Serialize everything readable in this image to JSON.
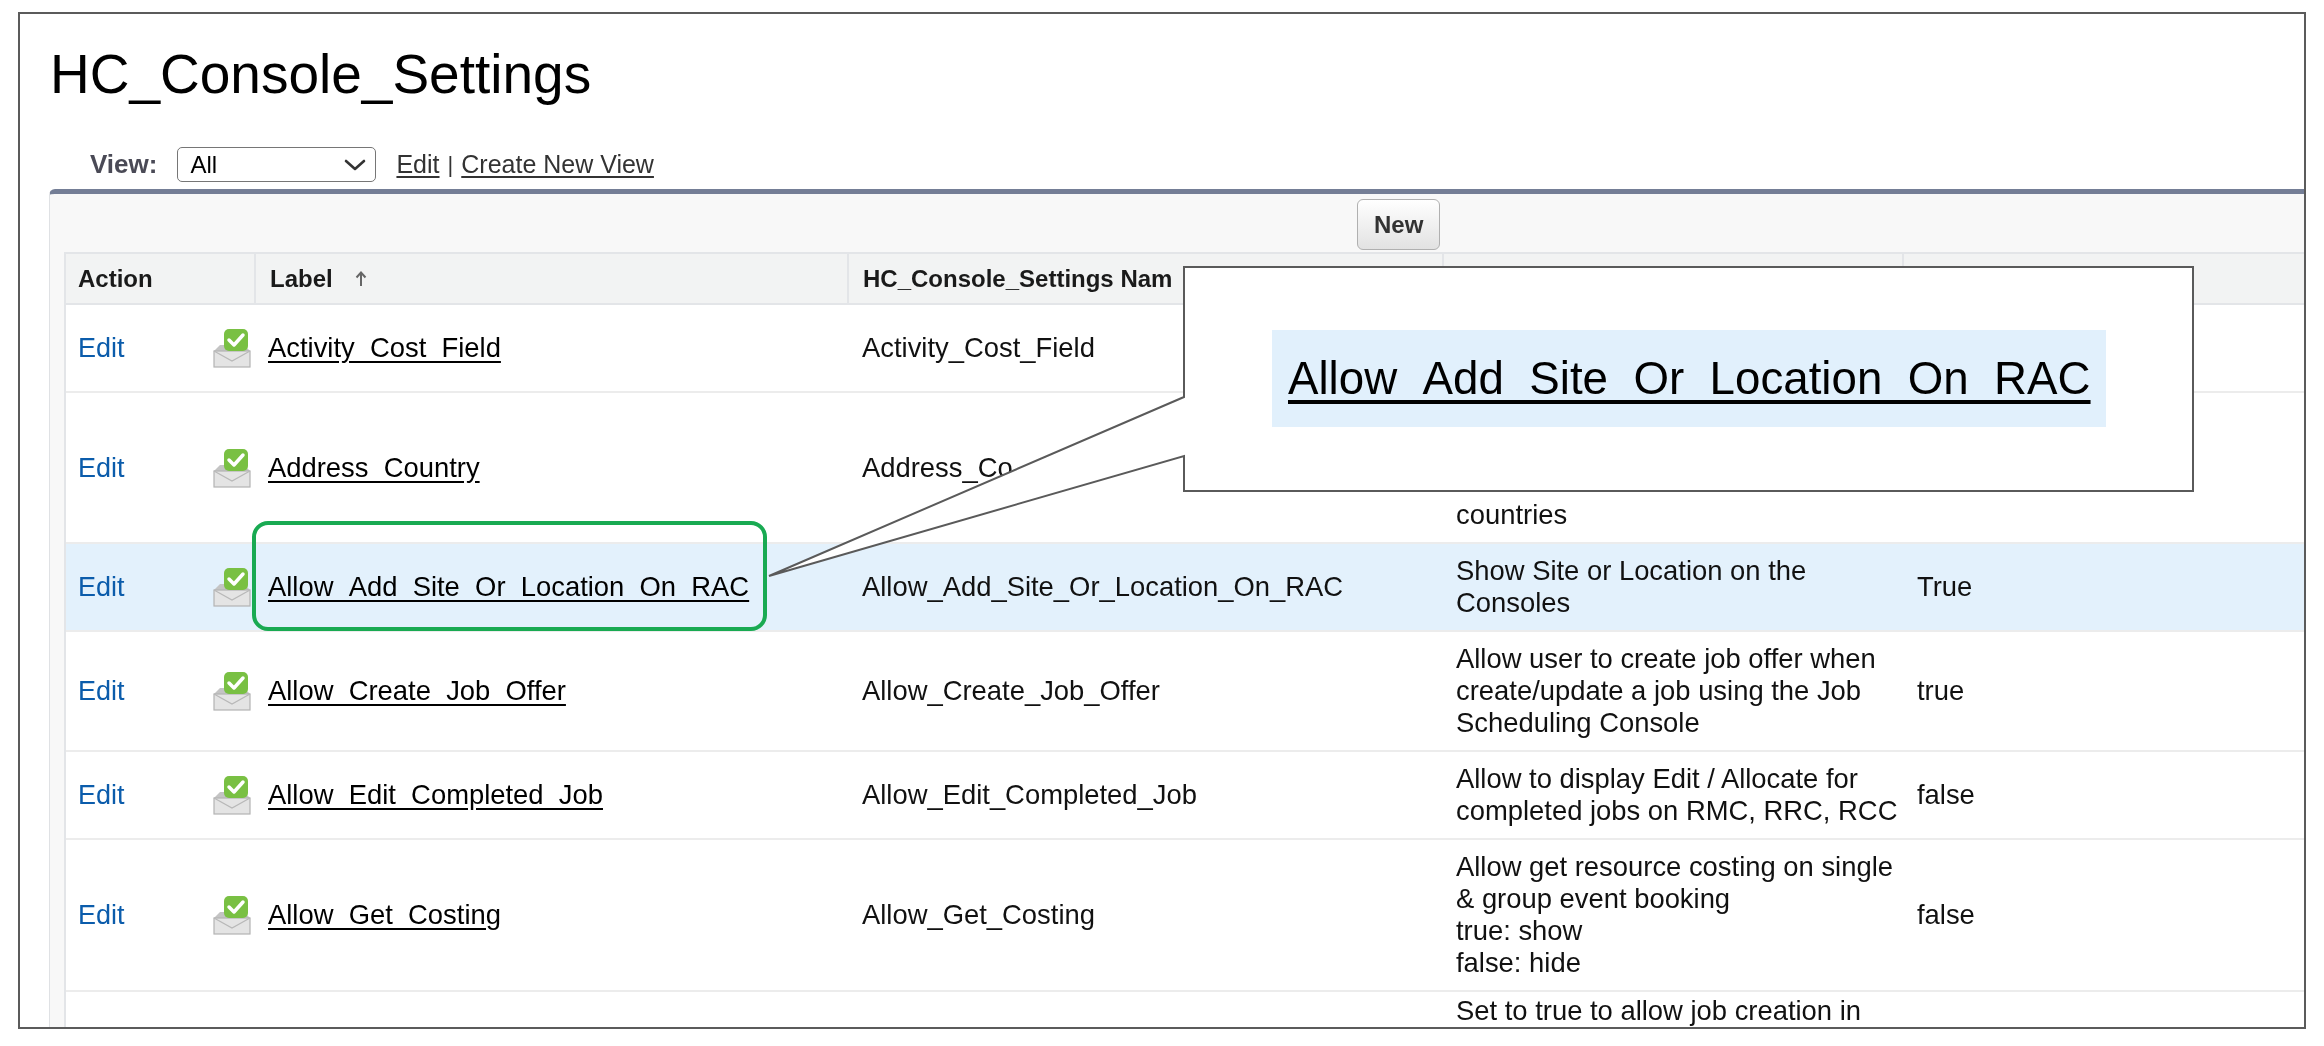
{
  "title": "HC_Console_Settings",
  "view_bar": {
    "label": "View:",
    "select": {
      "value": "All"
    },
    "links": [
      "Edit",
      "Create New View"
    ],
    "separator": "|"
  },
  "toolbar": {
    "buttons": [
      "New"
    ]
  },
  "table": {
    "columns": [
      {
        "label": "Action",
        "sorted": false
      },
      {
        "label": "Label",
        "sorted": true
      },
      {
        "label": "HC_Console_Settings Nam",
        "sorted": false
      }
    ],
    "rows": [
      {
        "action": "Edit",
        "label": "Activity_Cost_Field",
        "column_3": "Activity_Cost_Field",
        "highlighted": false,
        "framed": false
      },
      {
        "action": "Edit",
        "label": "Address_Country",
        "column_3": "Address_Co",
        "column_4": "countries",
        "highlighted": false,
        "framed": false
      },
      {
        "action": "Edit",
        "label": "Allow_Add_Site_Or_Location_On_RAC",
        "column_3": "Allow_Add_Site_Or_Location_On_RAC",
        "column_4": "Show Site or Location on the\nConsoles",
        "column_5": "True",
        "highlighted": true,
        "framed": true
      },
      {
        "action": "Edit",
        "label": "Allow_Create_Job_Offer",
        "column_3": "Allow_Create_Job_Offer",
        "column_4": "Allow user to create job offer when\ncreate/update a job using the Job\nScheduling Console",
        "column_5": "true",
        "highlighted": false,
        "framed": false
      },
      {
        "action": "Edit",
        "label": "Allow_Edit_Completed_Job",
        "column_3": "Allow_Edit_Completed_Job",
        "column_4": "Allow to display Edit / Allocate for\ncompleted jobs on RMC, RRC, RCC",
        "column_5": "false",
        "highlighted": false,
        "framed": false
      },
      {
        "action": "Edit",
        "label": "Allow_Get_Costing",
        "column_3": "Allow_Get_Costing",
        "column_4": "Allow get resource costing on single\n& group event booking\ntrue: show\nfalse: hide",
        "column_5": "false",
        "highlighted": false,
        "framed": false
      },
      {
        "column_4": "Set to true to allow job creation in",
        "highlighted": false,
        "framed": false
      }
    ]
  },
  "callout": {
    "text": "Allow_Add_Site_Or_Location_On_RAC"
  }
}
